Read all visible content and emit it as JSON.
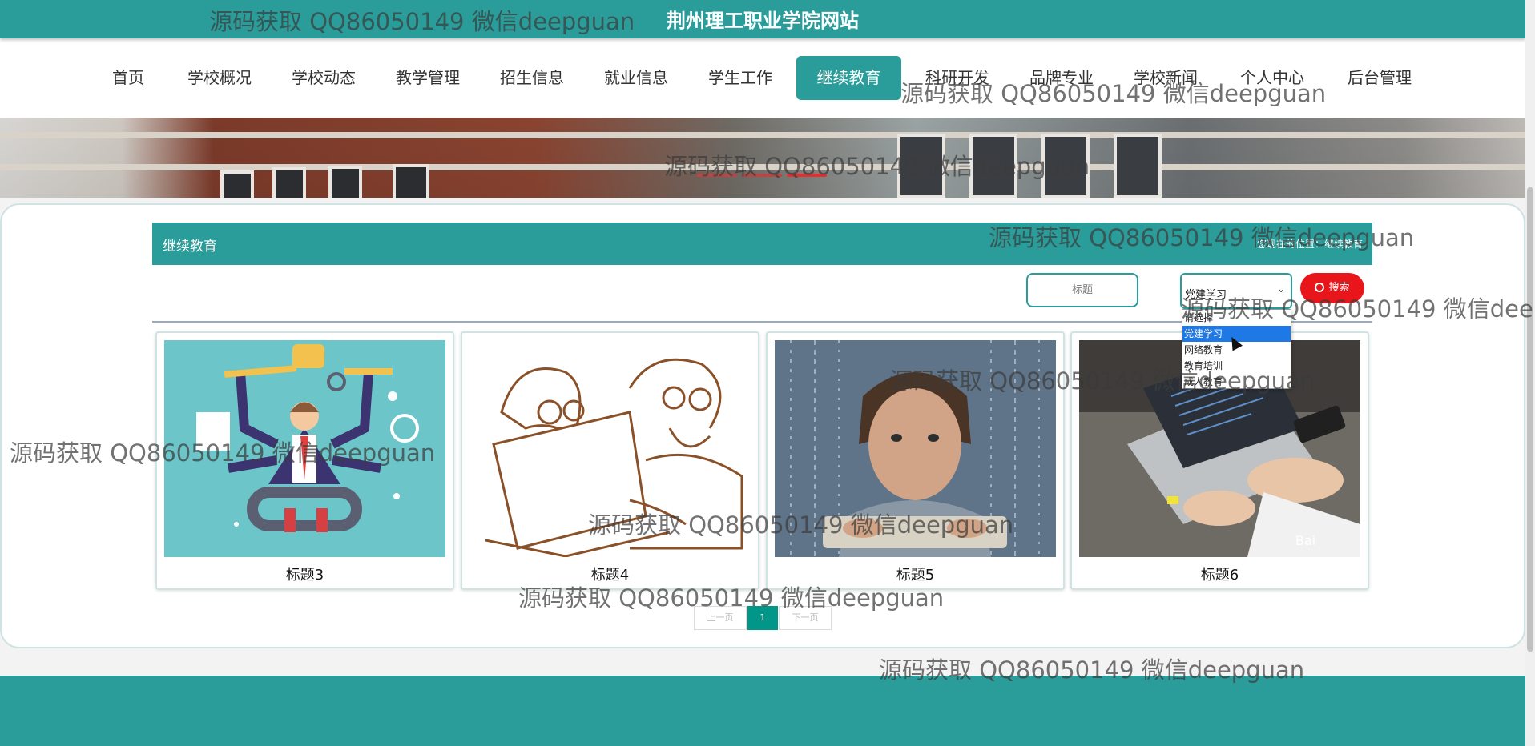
{
  "site": {
    "title": "荆州理工职业学院网站"
  },
  "nav": {
    "items": [
      "首页",
      "学校概况",
      "学校动态",
      "教学管理",
      "招生信息",
      "就业信息",
      "学生工作",
      "继续教育",
      "科研开发",
      "品牌专业",
      "学校新闻",
      "个人中心",
      "后台管理"
    ],
    "active_index": 7
  },
  "section": {
    "title": "继续教育",
    "breadcrumb": "您现在的位置：继续教育"
  },
  "search": {
    "title_placeholder": "标题",
    "select_value": "党建学习",
    "options": [
      "请选择",
      "党建学习",
      "网络教育",
      "教育培训",
      "成人教育"
    ],
    "selected_option_index": 1,
    "button_label": "搜索"
  },
  "cards": [
    {
      "title": "标题3"
    },
    {
      "title": "标题4"
    },
    {
      "title": "标题5"
    },
    {
      "title": "标题6"
    }
  ],
  "pagination": {
    "prev": "上一页",
    "current": "1",
    "next": "下一页"
  },
  "watermark": {
    "text": "源码获取 QQ86050149 微信deepguan"
  },
  "colors": {
    "primary": "#2a9d9a",
    "search_button": "#e8161b",
    "selected_option": "#1e78e6"
  }
}
